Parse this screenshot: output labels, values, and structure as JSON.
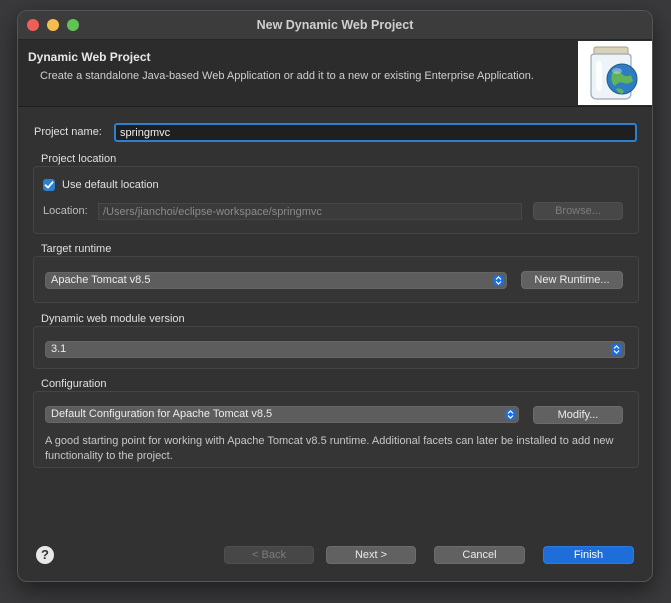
{
  "window": {
    "title": "New Dynamic Web Project"
  },
  "banner": {
    "title": "Dynamic Web Project",
    "description": "Create a standalone Java-based Web Application or add it to a new or existing Enterprise Application.",
    "image_icon": "web-project-jar-globe-icon"
  },
  "project_name": {
    "label": "Project name:",
    "value": "springmvc"
  },
  "project_location": {
    "group_title": "Project location",
    "use_default_label": "Use default location",
    "use_default_checked": true,
    "location_label": "Location:",
    "location_value": "/Users/jianchoi/eclipse-workspace/springmvc",
    "browse_label": "Browse..."
  },
  "target_runtime": {
    "group_title": "Target runtime",
    "selected": "Apache Tomcat v8.5",
    "new_runtime_label": "New Runtime..."
  },
  "web_module": {
    "group_title": "Dynamic web module version",
    "selected": "3.1"
  },
  "configuration": {
    "group_title": "Configuration",
    "selected": "Default Configuration for Apache Tomcat v8.5",
    "modify_label": "Modify...",
    "description": "A good starting point for working with Apache Tomcat v8.5 runtime. Additional facets can later be installed to add new functionality to the project."
  },
  "footer": {
    "help_label": "?",
    "back_label": "< Back",
    "next_label": "Next >",
    "cancel_label": "Cancel",
    "finish_label": "Finish"
  },
  "colors": {
    "accent": "#1d6ed8",
    "focus_ring": "#2f7fcf",
    "window_bg": "#323232"
  }
}
